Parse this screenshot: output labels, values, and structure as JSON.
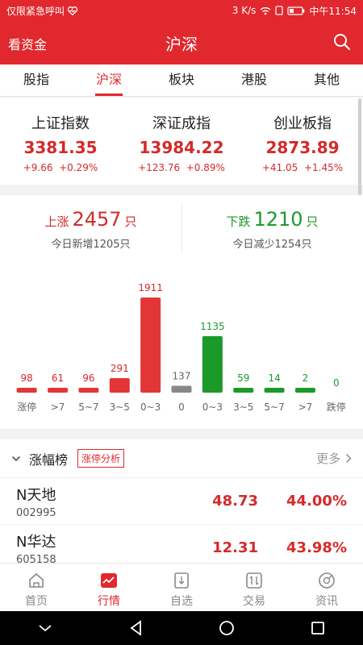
{
  "status": {
    "left_text": "仅限紧急呼叫",
    "speed": "3 K/s",
    "time": "中午11:54"
  },
  "appbar": {
    "left_label": "看资金",
    "title": "沪深"
  },
  "tabs": [
    "股指",
    "沪深",
    "板块",
    "港股",
    "其他"
  ],
  "indices": [
    {
      "name": "上证指数",
      "value": "3381.35",
      "change": "+9.66",
      "pct": "+0.29%"
    },
    {
      "name": "深证成指",
      "value": "13984.22",
      "change": "+123.76",
      "pct": "+0.89%"
    },
    {
      "name": "创业板指",
      "value": "2873.89",
      "change": "+41.05",
      "pct": "+1.45%"
    }
  ],
  "updown": {
    "up": {
      "label": "上涨",
      "count": "2457",
      "unit": "只",
      "sub": "今日新增1205只"
    },
    "down": {
      "label": "下跌",
      "count": "1210",
      "unit": "只",
      "sub": "今日减少1254只"
    }
  },
  "chart_data": {
    "type": "bar",
    "categories": [
      "涨停",
      ">7",
      "5~7",
      "3~5",
      "0~3",
      "0",
      "0~3",
      "3~5",
      "5~7",
      ">7",
      "跌停"
    ],
    "values": [
      98,
      61,
      96,
      291,
      1911,
      137,
      1135,
      59,
      14,
      2,
      0
    ],
    "colors": [
      "#e23636",
      "#e23636",
      "#e23636",
      "#e23636",
      "#e23636",
      "#888888",
      "#1b9a2a",
      "#1b9a2a",
      "#1b9a2a",
      "#1b9a2a",
      "#1b9a2a"
    ],
    "label_colors": [
      "#d42a2a",
      "#d42a2a",
      "#d42a2a",
      "#d42a2a",
      "#d42a2a",
      "#666666",
      "#1b9a2a",
      "#1b9a2a",
      "#1b9a2a",
      "#1b9a2a",
      "#1b9a2a"
    ],
    "ylim": [
      0,
      1911
    ]
  },
  "ranklist": {
    "title": "涨幅榜",
    "tag": "涨停分析",
    "more": "更多",
    "rows": [
      {
        "name": "N天地",
        "code": "002995",
        "price": "48.73",
        "pct": "44.00%"
      },
      {
        "name": "N华达",
        "code": "605158",
        "price": "12.31",
        "pct": "43.98%"
      }
    ]
  },
  "bottomnav": [
    "首页",
    "行情",
    "自选",
    "交易",
    "资讯"
  ],
  "colors": {
    "brand": "#e0282e",
    "up": "#d42a2a",
    "down": "#1b9a2a"
  }
}
